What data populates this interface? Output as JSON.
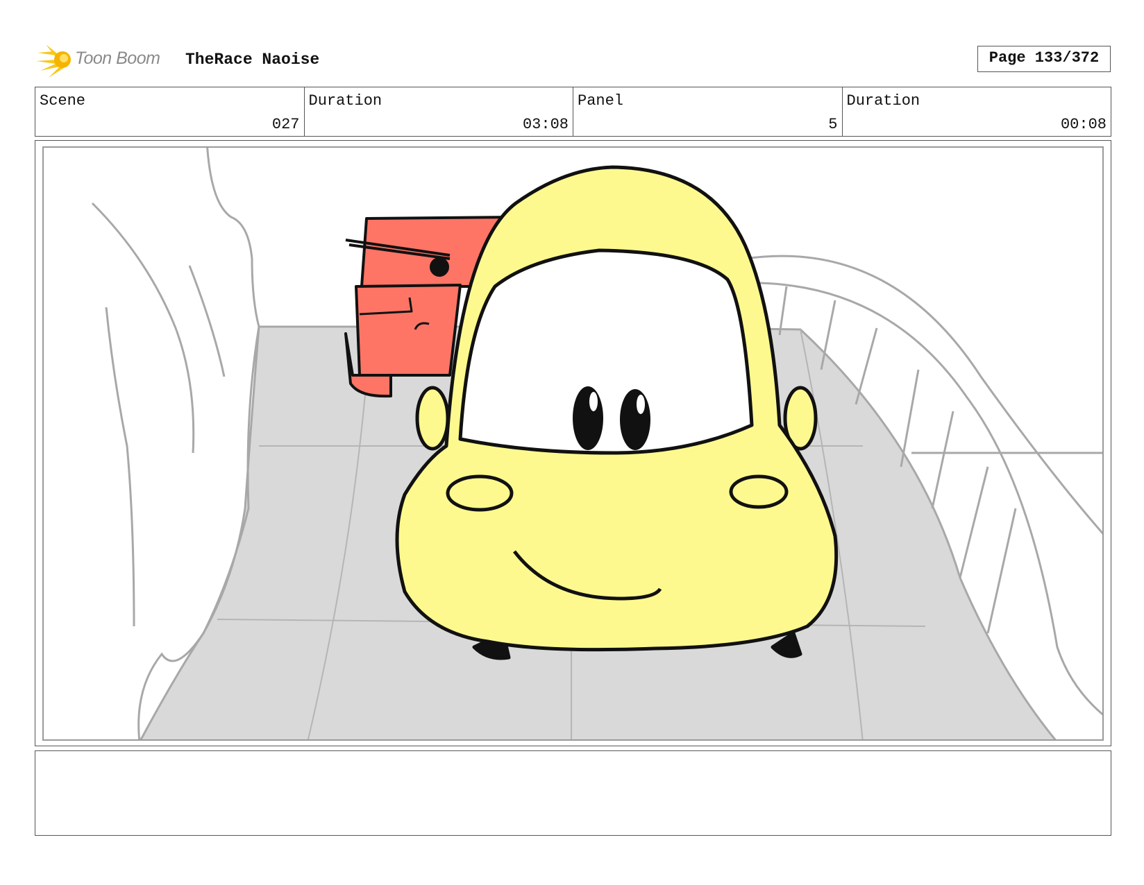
{
  "header": {
    "logo_text": "Toon Boom",
    "project_title": "TheRace Naoise",
    "page_label": "Page 133/372"
  },
  "info": {
    "scene_label": "Scene",
    "scene_value": "027",
    "scene_duration_label": "Duration",
    "scene_duration_value": "03:08",
    "panel_label": "Panel",
    "panel_value": "5",
    "panel_duration_label": "Duration",
    "panel_duration_value": "00:08"
  },
  "colors": {
    "car_yellow": "#fdf98f",
    "truck_red": "#fe7566",
    "road_gray": "#d9d9d9",
    "sketch_gray": "#a8a8a8"
  },
  "notes": {
    "text": ""
  }
}
